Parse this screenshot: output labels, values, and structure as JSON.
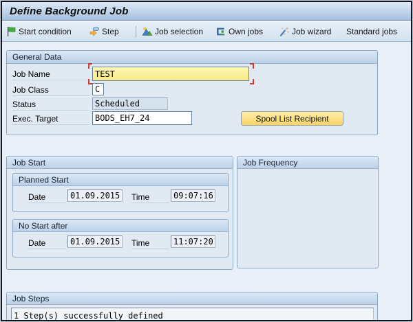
{
  "window": {
    "title": "Define Background Job"
  },
  "toolbar": {
    "items": [
      {
        "label": "Start condition",
        "icon": "flag-icon"
      },
      {
        "label": "Step",
        "icon": "step-icon"
      },
      {
        "label": "Job selection",
        "icon": "mountains-icon"
      },
      {
        "label": "Own jobs",
        "icon": "own-jobs-icon"
      },
      {
        "label": "Job wizard",
        "icon": "wand-icon"
      },
      {
        "label": "Standard jobs",
        "icon": ""
      }
    ]
  },
  "general_data": {
    "title": "General Data",
    "fields": {
      "job_name": {
        "label": "Job Name",
        "value": "TEST"
      },
      "job_class": {
        "label": "Job Class",
        "value": "C"
      },
      "status": {
        "label": "Status",
        "value": "Scheduled"
      },
      "exec_target": {
        "label": "Exec. Target",
        "value": "BODS_EH7_24"
      }
    },
    "spool_button_label": "Spool List Recipient"
  },
  "job_start": {
    "title": "Job Start",
    "planned_start": {
      "title": "Planned Start",
      "date_label": "Date",
      "date_value": "01.09.2015",
      "time_label": "Time",
      "time_value": "09:07:16"
    },
    "no_start_after": {
      "title": "No Start after",
      "date_label": "Date",
      "date_value": "01.09.2015",
      "time_label": "Time",
      "time_value": "11:07:20"
    }
  },
  "job_frequency": {
    "title": "Job Frequency"
  },
  "job_steps": {
    "title": "Job Steps",
    "message": "1 Step(s) successfully defined"
  },
  "colors": {
    "field_highlight": "#f9ef9e",
    "button_yellow": "#f8dc6c",
    "focus_bracket_red": "#da382c",
    "group_header_blue": "#c3d6ec"
  }
}
